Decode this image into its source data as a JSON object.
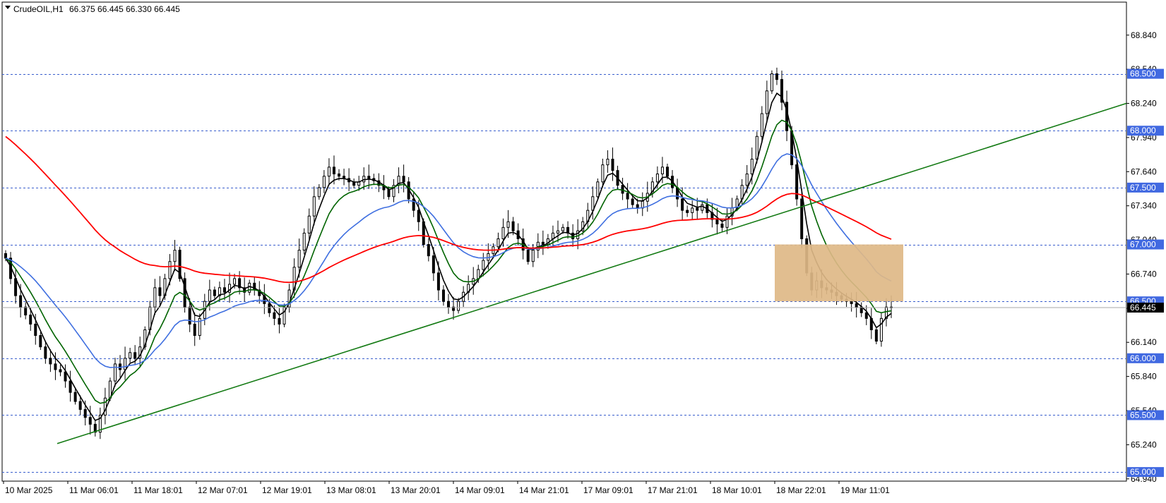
{
  "header": {
    "symbol": "CrudeOIL,H1",
    "ohlc": "66.375 66.445 66.330 66.445"
  },
  "chart_data": {
    "type": "candlestick",
    "symbol": "CrudeOIL",
    "timeframe": "H1",
    "y_range": [
      64.92,
      69.13
    ],
    "y_ticks": [
      "68.840",
      "68.540",
      "68.240",
      "67.940",
      "67.640",
      "67.340",
      "67.040",
      "66.740",
      "66.440",
      "66.140",
      "65.840",
      "65.540",
      "65.240",
      "64.940"
    ],
    "x_labels": [
      "10 Mar 2025",
      "11 Mar 06:01",
      "11 Mar 18:01",
      "12 Mar 07:01",
      "12 Mar 19:01",
      "13 Mar 08:01",
      "13 Mar 20:01",
      "14 Mar 09:01",
      "14 Mar 21:01",
      "17 Mar 09:01",
      "17 Mar 21:01",
      "18 Mar 10:01",
      "18 Mar 22:01",
      "19 Mar 11:01"
    ],
    "price_levels": [
      "68.500",
      "68.000",
      "67.500",
      "67.000",
      "66.500",
      "66.000",
      "65.500",
      "65.000"
    ],
    "current_price": "66.445",
    "candles_close": [
      66.88,
      66.7,
      66.55,
      66.45,
      66.38,
      66.3,
      66.2,
      66.1,
      66.0,
      65.95,
      65.9,
      65.88,
      65.8,
      65.7,
      65.62,
      65.55,
      65.48,
      65.42,
      65.35,
      65.5,
      65.65,
      65.8,
      65.95,
      65.9,
      66.0,
      66.05,
      66.0,
      66.1,
      66.25,
      66.45,
      66.62,
      66.55,
      66.7,
      66.85,
      66.95,
      66.7,
      66.45,
      66.3,
      66.2,
      66.35,
      66.5,
      66.6,
      66.55,
      66.62,
      66.58,
      66.65,
      66.7,
      66.62,
      66.58,
      66.66,
      66.6,
      66.55,
      66.48,
      66.4,
      66.35,
      66.3,
      66.45,
      66.6,
      66.8,
      66.95,
      67.1,
      67.25,
      67.42,
      67.5,
      67.6,
      67.68,
      67.62,
      67.6,
      67.58,
      67.55,
      67.52,
      67.55,
      67.6,
      67.58,
      67.56,
      67.52,
      67.48,
      67.42,
      67.52,
      67.6,
      67.55,
      67.4,
      67.3,
      67.2,
      67.0,
      66.9,
      66.75,
      66.6,
      66.5,
      66.45,
      66.42,
      66.5,
      66.58,
      66.65,
      66.7,
      66.78,
      66.86,
      66.92,
      66.98,
      67.05,
      67.15,
      67.2,
      67.12,
      67.05,
      66.95,
      66.85,
      66.95,
      67.02,
      67.0,
      67.05,
      67.1,
      67.12,
      67.15,
      67.1,
      67.05,
      67.12,
      67.2,
      67.3,
      67.42,
      67.55,
      67.7,
      67.75,
      67.65,
      67.52,
      67.45,
      67.4,
      67.35,
      67.32,
      67.38,
      67.45,
      67.55,
      67.62,
      67.68,
      67.6,
      67.5,
      67.4,
      67.3,
      67.28,
      67.32,
      67.3,
      67.35,
      67.28,
      67.22,
      67.18,
      67.15,
      67.25,
      67.32,
      67.4,
      67.52,
      67.62,
      67.75,
      67.95,
      68.15,
      68.35,
      68.5,
      68.45,
      68.25,
      68.0,
      67.7,
      67.4,
      67.05,
      66.75,
      66.6,
      66.68,
      66.62,
      66.6,
      66.58,
      66.55,
      66.52,
      66.5,
      66.48,
      66.45,
      66.4,
      66.35,
      66.25,
      66.15,
      66.35,
      66.45,
      66.445
    ]
  },
  "colors": {
    "background": "#ffffff",
    "grid": "#3a5fcd",
    "ma_black": "#000000",
    "ma_green": "#006400",
    "ma_blue": "#3f6fe0",
    "ma_red": "#ff0000",
    "trendline": "#137a13",
    "zone": "#deb887",
    "label_bg": "#4169e1",
    "current_bg": "#000000"
  },
  "icons": {
    "header_marker": "triangle-down-icon"
  }
}
